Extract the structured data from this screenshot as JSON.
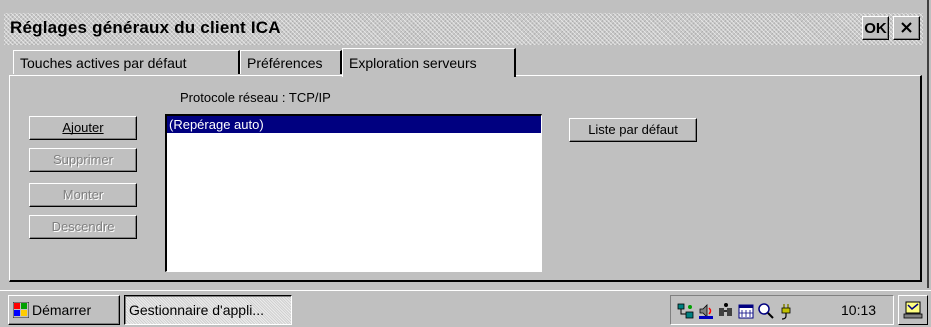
{
  "window": {
    "title": "Réglages généraux du client ICA",
    "ok_label": "OK"
  },
  "tabs": [
    {
      "label": "Touches actives par défaut",
      "active": false
    },
    {
      "label": "Préférences",
      "active": false
    },
    {
      "label": "Exploration serveurs",
      "active": true
    }
  ],
  "panel": {
    "protocol_label": "Protocole réseau : TCP/IP",
    "buttons": {
      "add": {
        "label": "Ajouter",
        "enabled": true
      },
      "remove": {
        "label": "Supprimer",
        "enabled": false
      },
      "move_up": {
        "label": "Monter",
        "enabled": false
      },
      "move_down": {
        "label": "Descendre",
        "enabled": false
      },
      "default_list": {
        "label": "Liste par défaut",
        "enabled": true
      }
    },
    "server_list": {
      "items": [
        "(Repérage auto)"
      ],
      "selected_index": 0
    }
  },
  "taskbar": {
    "start_label": "Démarrer",
    "task_label": "Gestionnaire d'appli...",
    "clock": "10:13",
    "tray_icons": [
      "network-icon",
      "volume-icon",
      "pc-connection-icon",
      "calendar-icon",
      "search-icon",
      "power-plug-icon"
    ]
  },
  "colors": {
    "selection": "#000080",
    "face": "#c0c0c0"
  }
}
